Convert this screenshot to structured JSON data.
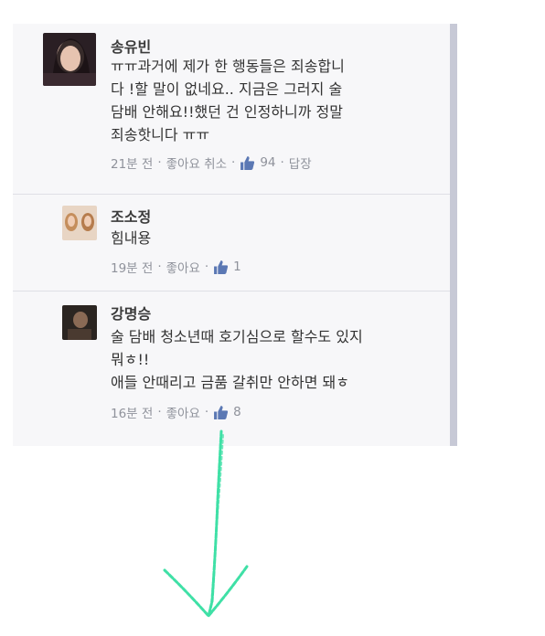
{
  "comments": [
    {
      "name": "송유빈",
      "lines": [
        "ㅠㅠ과거에 제가 한 행동들은 죄송합니",
        "다 !할 말이 없네요.. 지금은 그러지 술",
        "담배 안해요!!했던 건 인정하니까 정말",
        "죄송핫니다 ㅠㅠ"
      ],
      "time": "21분 전",
      "like_action": "좋아요 취소",
      "likes": "94",
      "reply": "답장"
    },
    {
      "name": "조소정",
      "lines": [
        "힘내용"
      ],
      "time": "19분 전",
      "like_action": "좋아요",
      "likes": "1"
    },
    {
      "name": "강명승",
      "lines": [
        "술 담배 청소년때 호기심으로 할수도 있지",
        "뭐ㅎ!!",
        "애들 안때리고 금품 갈취만 안하면 돼ㅎ"
      ],
      "time": "16분 전",
      "like_action": "좋아요",
      "likes": "8"
    }
  ],
  "separator": "·",
  "colors": {
    "arrow": "#3fe0a6",
    "panel_border": "#c7c9d6",
    "meta": "#8f929b",
    "like_icon": "#5b78b4"
  }
}
